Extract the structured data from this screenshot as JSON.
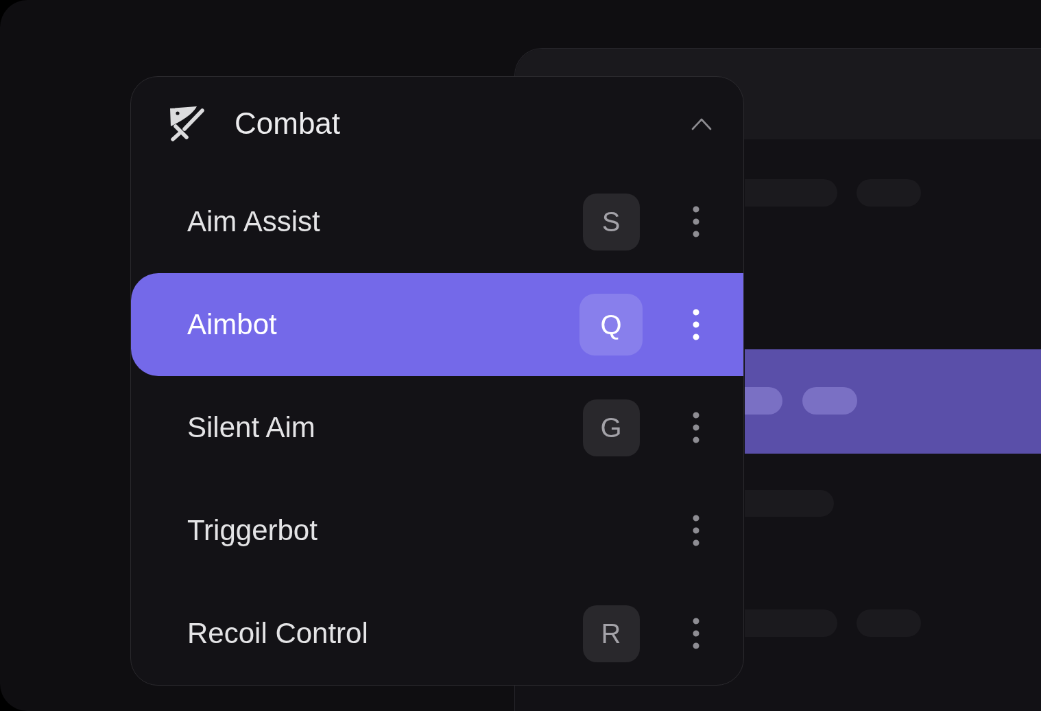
{
  "menu": {
    "title": "Combat",
    "expanded": true,
    "items": [
      {
        "label": "Aim Assist",
        "key": "S",
        "selected": false
      },
      {
        "label": "Aimbot",
        "key": "Q",
        "selected": true
      },
      {
        "label": "Silent Aim",
        "key": "G",
        "selected": false
      },
      {
        "label": "Triggerbot",
        "selected": false
      },
      {
        "label": "Recoil Control",
        "key": "R",
        "selected": false
      }
    ]
  }
}
